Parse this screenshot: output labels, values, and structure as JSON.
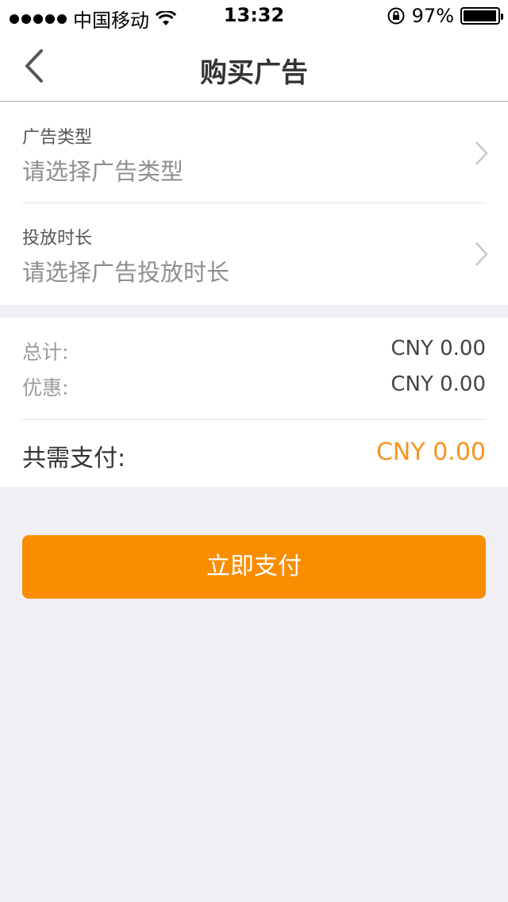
{
  "status_bar": {
    "carrier": "中国移动",
    "time": "13:32",
    "battery": "97%",
    "battery_level": 0.97,
    "icons": [
      "signal-dots-icon",
      "wifi-icon",
      "rotation-lock-icon",
      "battery-icon"
    ]
  },
  "nav": {
    "title": "购买广告",
    "back_icon": "chevron-left-icon"
  },
  "form": {
    "ad_type": {
      "label": "广告类型",
      "placeholder": "请选择广告类型"
    },
    "duration": {
      "label": "投放时长",
      "placeholder": "请选择广告投放时长"
    },
    "chevron_icon": "chevron-right-icon"
  },
  "summary": {
    "subtotal_label": "总计:",
    "subtotal_value": "CNY 0.00",
    "discount_label": "优惠:",
    "discount_value": "CNY 0.00",
    "total_label": "共需支付:",
    "total_value": "CNY 0.00"
  },
  "actions": {
    "pay_label": "立即支付"
  },
  "colors": {
    "accent": "#f98d00",
    "total_text": "#f7931e",
    "background": "#efeff4"
  }
}
